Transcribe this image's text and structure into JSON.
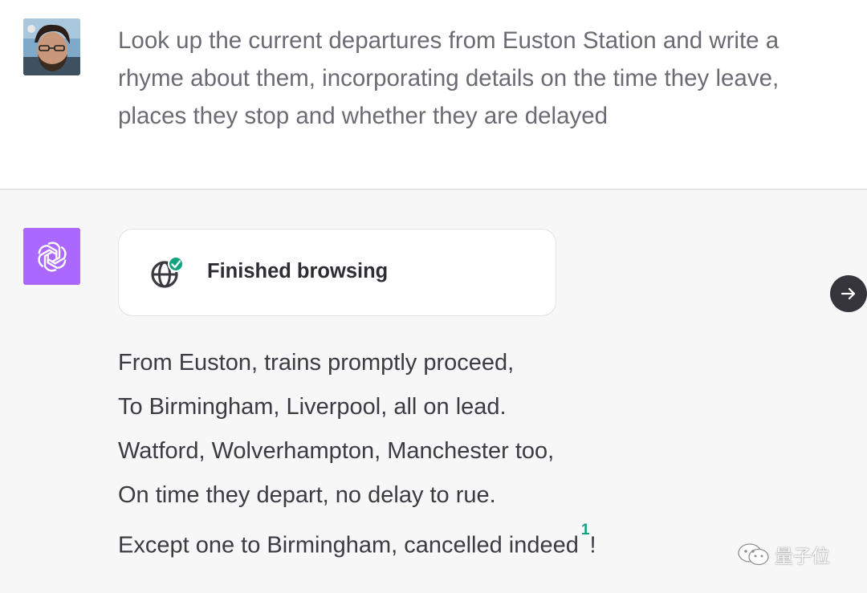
{
  "user_message": {
    "avatar": "user-avatar-photo",
    "text": "Look up the current departures from Euston Station and write a\nrhyme about them, incorporating details on the time they leave,\nplaces they stop and whether they are delayed"
  },
  "assistant": {
    "avatar": "openai-logo-icon",
    "avatar_color": "#ab68ff",
    "browsing": {
      "label": "Finished browsing",
      "icon": "globe-check-icon",
      "check_color": "#10a37f"
    },
    "poem_lines": [
      "From Euston, trains promptly proceed,",
      "To Birmingham, Liverpool, all on lead.",
      "Watford, Wolverhampton, Manchester too,",
      "On time they depart, no delay to rue."
    ],
    "last_line": {
      "text": "Except one to Birmingham, cancelled indeed",
      "footnote": "1",
      "ending": "!"
    }
  },
  "next_button": {
    "icon": "arrow-right-icon"
  },
  "watermark": {
    "text": "量子位",
    "icon": "wechat-icon"
  }
}
